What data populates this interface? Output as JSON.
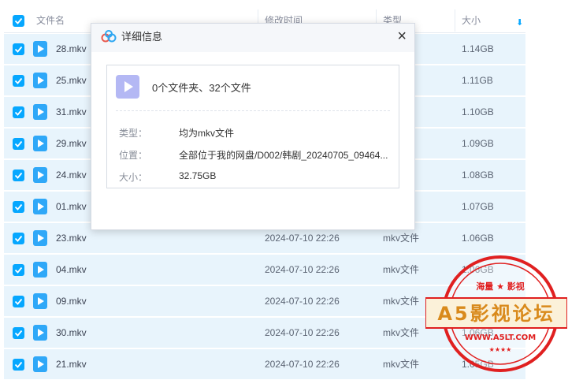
{
  "table": {
    "headers": {
      "name": "文件名",
      "modified": "修改时间",
      "type": "类型",
      "size": "大小"
    },
    "rows": [
      {
        "name": "28.mkv",
        "modified": "",
        "type": "件",
        "size": "1.14GB"
      },
      {
        "name": "25.mkv",
        "modified": "",
        "type": "件",
        "size": "1.11GB"
      },
      {
        "name": "31.mkv",
        "modified": "",
        "type": "件",
        "size": "1.10GB"
      },
      {
        "name": "29.mkv",
        "modified": "",
        "type": "件",
        "size": "1.09GB"
      },
      {
        "name": "24.mkv",
        "modified": "",
        "type": "件",
        "size": "1.08GB"
      },
      {
        "name": "01.mkv",
        "modified": "",
        "type": "件",
        "size": "1.07GB"
      },
      {
        "name": "23.mkv",
        "modified": "2024-07-10 22:26",
        "type": "mkv文件",
        "size": "1.06GB"
      },
      {
        "name": "04.mkv",
        "modified": "2024-07-10 22:26",
        "type": "mkv文件",
        "size": "1.06GB"
      },
      {
        "name": "09.mkv",
        "modified": "2024-07-10 22:26",
        "type": "mkv文件",
        "size": "1.06GB"
      },
      {
        "name": "30.mkv",
        "modified": "2024-07-10 22:26",
        "type": "mkv文件",
        "size": "1.06GB"
      },
      {
        "name": "21.mkv",
        "modified": "2024-07-10 22:26",
        "type": "mkv文件",
        "size": "1.05GB"
      }
    ]
  },
  "dialog": {
    "title": "详细信息",
    "close": "×",
    "summary": "0个文件夹、32个文件",
    "type_label": "类型：",
    "type_value": "均为mkv文件",
    "location_label": "位置：",
    "location_value": "全部位于我的网盘/D002/韩剧_20240705_09464...",
    "size_label": "大小：",
    "size_value": "32.75GB"
  },
  "watermark": {
    "top_text": "海量 ★ 影视",
    "main_text": "A5影视论坛",
    "url": "WWW.A5LT.COM"
  },
  "colors": {
    "accent": "#06a7ff",
    "row_selected": "#e8f4fc",
    "stamp_red": "#e02020",
    "banner_bg": "#fbf1d9",
    "banner_text": "#d98a1c"
  },
  "icons": {
    "checkbox": "checkbox-checked-icon",
    "video": "video-file-icon",
    "sort": "sort-down-arrow-icon",
    "logo": "baidu-netdisk-cloud-icon"
  }
}
